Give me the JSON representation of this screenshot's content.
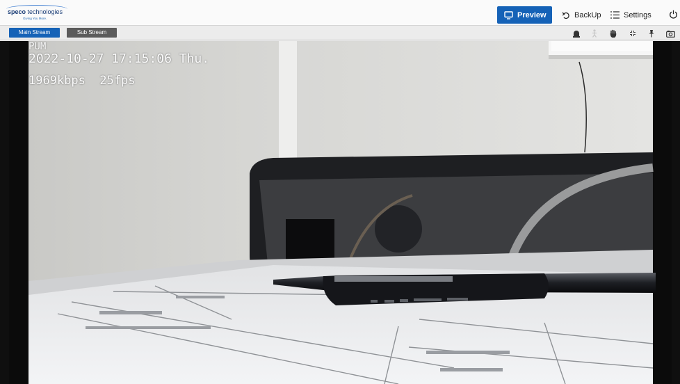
{
  "logo": {
    "brand_bold": "speco",
    "brand_rest": " technologies",
    "tagline": "Giving You More."
  },
  "nav": {
    "preview": "Preview",
    "backup": "BackUp",
    "settings": "Settings"
  },
  "streams": {
    "main": "Main Stream",
    "sub": "Sub Stream"
  },
  "toolbar_icons": [
    "alarm-icon",
    "person-icon",
    "hand-icon",
    "fullscreen-icon",
    "pin-icon",
    "snapshot-icon"
  ],
  "osd": {
    "channel": "PUM",
    "datetime": "2022-10-27 17:15:06 Thu.",
    "stats": "1969kbps  25fps"
  },
  "colors": {
    "accent": "#1562b7",
    "stream_main": "#1562b7",
    "stream_sub": "#5b5b5b"
  }
}
